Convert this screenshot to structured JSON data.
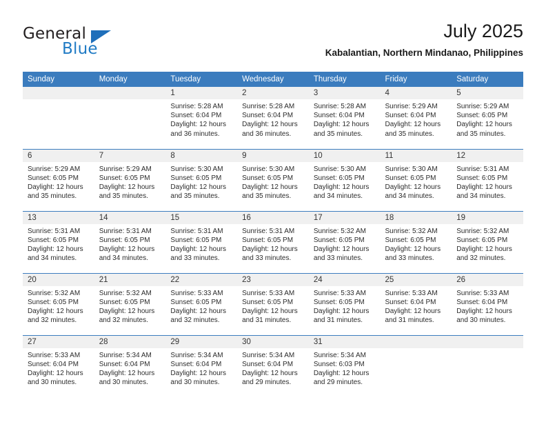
{
  "brand": {
    "name_part1": "General",
    "name_part2": "Blue",
    "triangle_color": "#1f6fba",
    "blue_color": "#1f7ac4"
  },
  "header": {
    "title": "July 2025",
    "subtitle": "Kabalantian, Northern Mindanao, Philippines"
  },
  "theme": {
    "header_row_bg": "#3b7cbe",
    "daynum_bg": "#f0f0f0",
    "grid_line": "#3b7cbe",
    "text": "#2b2b2b"
  },
  "weekdays": [
    "Sunday",
    "Monday",
    "Tuesday",
    "Wednesday",
    "Thursday",
    "Friday",
    "Saturday"
  ],
  "weeks": [
    [
      {
        "day": "",
        "sunrise": "",
        "sunset": "",
        "daylight": "",
        "blank": true
      },
      {
        "day": "",
        "sunrise": "",
        "sunset": "",
        "daylight": "",
        "blank": true
      },
      {
        "day": "1",
        "sunrise": "Sunrise: 5:28 AM",
        "sunset": "Sunset: 6:04 PM",
        "daylight": "Daylight: 12 hours and 36 minutes."
      },
      {
        "day": "2",
        "sunrise": "Sunrise: 5:28 AM",
        "sunset": "Sunset: 6:04 PM",
        "daylight": "Daylight: 12 hours and 36 minutes."
      },
      {
        "day": "3",
        "sunrise": "Sunrise: 5:28 AM",
        "sunset": "Sunset: 6:04 PM",
        "daylight": "Daylight: 12 hours and 35 minutes."
      },
      {
        "day": "4",
        "sunrise": "Sunrise: 5:29 AM",
        "sunset": "Sunset: 6:04 PM",
        "daylight": "Daylight: 12 hours and 35 minutes."
      },
      {
        "day": "5",
        "sunrise": "Sunrise: 5:29 AM",
        "sunset": "Sunset: 6:05 PM",
        "daylight": "Daylight: 12 hours and 35 minutes."
      }
    ],
    [
      {
        "day": "6",
        "sunrise": "Sunrise: 5:29 AM",
        "sunset": "Sunset: 6:05 PM",
        "daylight": "Daylight: 12 hours and 35 minutes."
      },
      {
        "day": "7",
        "sunrise": "Sunrise: 5:29 AM",
        "sunset": "Sunset: 6:05 PM",
        "daylight": "Daylight: 12 hours and 35 minutes."
      },
      {
        "day": "8",
        "sunrise": "Sunrise: 5:30 AM",
        "sunset": "Sunset: 6:05 PM",
        "daylight": "Daylight: 12 hours and 35 minutes."
      },
      {
        "day": "9",
        "sunrise": "Sunrise: 5:30 AM",
        "sunset": "Sunset: 6:05 PM",
        "daylight": "Daylight: 12 hours and 35 minutes."
      },
      {
        "day": "10",
        "sunrise": "Sunrise: 5:30 AM",
        "sunset": "Sunset: 6:05 PM",
        "daylight": "Daylight: 12 hours and 34 minutes."
      },
      {
        "day": "11",
        "sunrise": "Sunrise: 5:30 AM",
        "sunset": "Sunset: 6:05 PM",
        "daylight": "Daylight: 12 hours and 34 minutes."
      },
      {
        "day": "12",
        "sunrise": "Sunrise: 5:31 AM",
        "sunset": "Sunset: 6:05 PM",
        "daylight": "Daylight: 12 hours and 34 minutes."
      }
    ],
    [
      {
        "day": "13",
        "sunrise": "Sunrise: 5:31 AM",
        "sunset": "Sunset: 6:05 PM",
        "daylight": "Daylight: 12 hours and 34 minutes."
      },
      {
        "day": "14",
        "sunrise": "Sunrise: 5:31 AM",
        "sunset": "Sunset: 6:05 PM",
        "daylight": "Daylight: 12 hours and 34 minutes."
      },
      {
        "day": "15",
        "sunrise": "Sunrise: 5:31 AM",
        "sunset": "Sunset: 6:05 PM",
        "daylight": "Daylight: 12 hours and 33 minutes."
      },
      {
        "day": "16",
        "sunrise": "Sunrise: 5:31 AM",
        "sunset": "Sunset: 6:05 PM",
        "daylight": "Daylight: 12 hours and 33 minutes."
      },
      {
        "day": "17",
        "sunrise": "Sunrise: 5:32 AM",
        "sunset": "Sunset: 6:05 PM",
        "daylight": "Daylight: 12 hours and 33 minutes."
      },
      {
        "day": "18",
        "sunrise": "Sunrise: 5:32 AM",
        "sunset": "Sunset: 6:05 PM",
        "daylight": "Daylight: 12 hours and 33 minutes."
      },
      {
        "day": "19",
        "sunrise": "Sunrise: 5:32 AM",
        "sunset": "Sunset: 6:05 PM",
        "daylight": "Daylight: 12 hours and 32 minutes."
      }
    ],
    [
      {
        "day": "20",
        "sunrise": "Sunrise: 5:32 AM",
        "sunset": "Sunset: 6:05 PM",
        "daylight": "Daylight: 12 hours and 32 minutes."
      },
      {
        "day": "21",
        "sunrise": "Sunrise: 5:32 AM",
        "sunset": "Sunset: 6:05 PM",
        "daylight": "Daylight: 12 hours and 32 minutes."
      },
      {
        "day": "22",
        "sunrise": "Sunrise: 5:33 AM",
        "sunset": "Sunset: 6:05 PM",
        "daylight": "Daylight: 12 hours and 32 minutes."
      },
      {
        "day": "23",
        "sunrise": "Sunrise: 5:33 AM",
        "sunset": "Sunset: 6:05 PM",
        "daylight": "Daylight: 12 hours and 31 minutes."
      },
      {
        "day": "24",
        "sunrise": "Sunrise: 5:33 AM",
        "sunset": "Sunset: 6:05 PM",
        "daylight": "Daylight: 12 hours and 31 minutes."
      },
      {
        "day": "25",
        "sunrise": "Sunrise: 5:33 AM",
        "sunset": "Sunset: 6:04 PM",
        "daylight": "Daylight: 12 hours and 31 minutes."
      },
      {
        "day": "26",
        "sunrise": "Sunrise: 5:33 AM",
        "sunset": "Sunset: 6:04 PM",
        "daylight": "Daylight: 12 hours and 30 minutes."
      }
    ],
    [
      {
        "day": "27",
        "sunrise": "Sunrise: 5:33 AM",
        "sunset": "Sunset: 6:04 PM",
        "daylight": "Daylight: 12 hours and 30 minutes."
      },
      {
        "day": "28",
        "sunrise": "Sunrise: 5:34 AM",
        "sunset": "Sunset: 6:04 PM",
        "daylight": "Daylight: 12 hours and 30 minutes."
      },
      {
        "day": "29",
        "sunrise": "Sunrise: 5:34 AM",
        "sunset": "Sunset: 6:04 PM",
        "daylight": "Daylight: 12 hours and 30 minutes."
      },
      {
        "day": "30",
        "sunrise": "Sunrise: 5:34 AM",
        "sunset": "Sunset: 6:04 PM",
        "daylight": "Daylight: 12 hours and 29 minutes."
      },
      {
        "day": "31",
        "sunrise": "Sunrise: 5:34 AM",
        "sunset": "Sunset: 6:03 PM",
        "daylight": "Daylight: 12 hours and 29 minutes."
      },
      {
        "day": "",
        "sunrise": "",
        "sunset": "",
        "daylight": "",
        "blank": true
      },
      {
        "day": "",
        "sunrise": "",
        "sunset": "",
        "daylight": "",
        "blank": true
      }
    ]
  ]
}
